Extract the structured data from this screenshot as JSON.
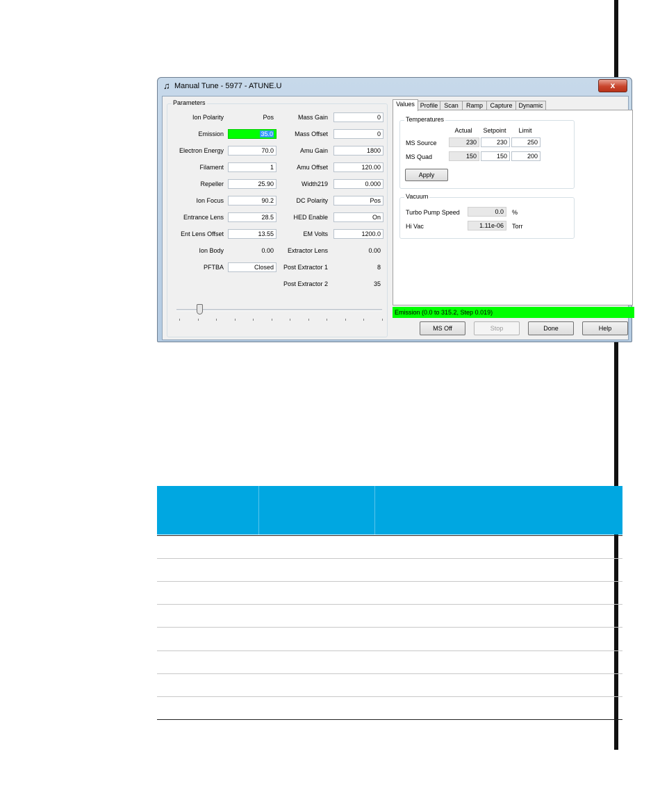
{
  "window": {
    "title": "Manual Tune - 5977 - ATUNE.U",
    "close_label": "x"
  },
  "parameters": {
    "group_title": "Parameters",
    "left": [
      {
        "label": "Ion Polarity",
        "value": "Pos"
      },
      {
        "label": "Emission",
        "value": "35.0"
      },
      {
        "label": "Electron Energy",
        "value": "70.0"
      },
      {
        "label": "Filament",
        "value": "1"
      },
      {
        "label": "Repeller",
        "value": "25.90"
      },
      {
        "label": "Ion Focus",
        "value": "90.2"
      },
      {
        "label": "Entrance Lens",
        "value": "28.5"
      },
      {
        "label": "Ent Lens Offset",
        "value": "13.55"
      },
      {
        "label": "Ion Body",
        "value": "0.00"
      },
      {
        "label": "PFTBA",
        "value": "Closed"
      }
    ],
    "right": [
      {
        "label": "Mass Gain",
        "value": "0"
      },
      {
        "label": "Mass Offset",
        "value": "0"
      },
      {
        "label": "Amu Gain",
        "value": "1800"
      },
      {
        "label": "Amu Offset",
        "value": "120.00"
      },
      {
        "label": "Width219",
        "value": "0.000"
      },
      {
        "label": "DC Polarity",
        "value": "Pos"
      },
      {
        "label": "HED Enable",
        "value": "On"
      },
      {
        "label": "EM Volts",
        "value": "1200.0"
      },
      {
        "label": "Extractor Lens",
        "value": "0.00"
      },
      {
        "label": "Post Extractor 1",
        "value": "8"
      },
      {
        "label": "Post Extractor 2",
        "value": "35"
      }
    ],
    "slider_level_fraction": 0.11
  },
  "tabs": [
    "Values",
    "Profile",
    "Scan",
    "Ramp",
    "Capture",
    "Dynamic"
  ],
  "active_tab": "Values",
  "temperatures": {
    "group_title": "Temperatures",
    "col_actual": "Actual",
    "col_setpoint": "Setpoint",
    "col_limit": "Limit",
    "rows": [
      {
        "label": "MS Source",
        "actual": "230",
        "setpoint": "230",
        "limit": "250"
      },
      {
        "label": "MS Quad",
        "actual": "150",
        "setpoint": "150",
        "limit": "200"
      }
    ],
    "apply_label": "Apply"
  },
  "vacuum": {
    "group_title": "Vacuum",
    "rows": [
      {
        "label": "Turbo Pump Speed",
        "value": "0.0",
        "unit": "%"
      },
      {
        "label": "Hi Vac",
        "value": "1.11e-06",
        "unit": "Torr"
      }
    ]
  },
  "status_text": "Emission (0.0 to 315.2, Step 0.019)",
  "status_color": "#00ff00",
  "buttons": {
    "ms_off": "MS Off",
    "stop": "Stop",
    "done": "Done",
    "help": "Help"
  },
  "colors": {
    "table_header": "#00a7e1",
    "highlight_field": "#00ff00"
  }
}
